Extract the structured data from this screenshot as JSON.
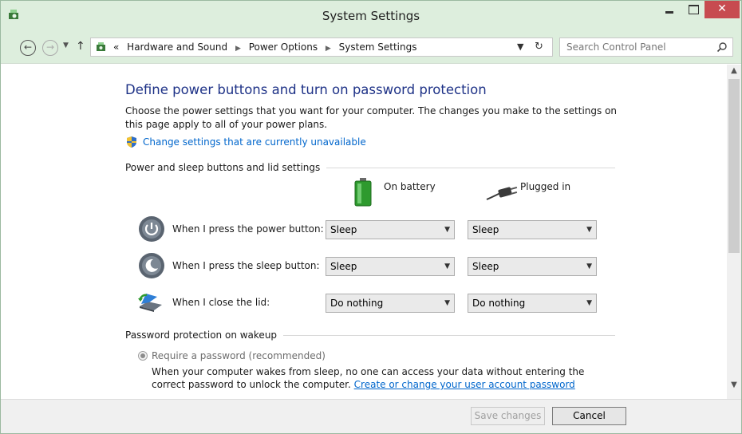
{
  "window": {
    "title": "System Settings"
  },
  "address_bar": {
    "prefix": "«",
    "crumbs": [
      "Hardware and Sound",
      "Power Options",
      "System Settings"
    ],
    "search_placeholder": "Search Control Panel"
  },
  "page": {
    "heading": "Define power buttons and turn on password protection",
    "description": "Choose the power settings that you want for your computer. The changes you make to the settings on this page apply to all of your power plans.",
    "change_link": "Change settings that are currently unavailable"
  },
  "buttons_section": {
    "label": "Power and sleep buttons and lid settings",
    "col_battery": "On battery",
    "col_plugged": "Plugged in",
    "rows": [
      {
        "label": "When I press the power button:",
        "battery": "Sleep",
        "plugged": "Sleep"
      },
      {
        "label": "When I press the sleep button:",
        "battery": "Sleep",
        "plugged": "Sleep"
      },
      {
        "label": "When I close the lid:",
        "battery": "Do nothing",
        "plugged": "Do nothing"
      }
    ]
  },
  "password_section": {
    "label": "Password protection on wakeup",
    "radio_label": "Require a password (recommended)",
    "radio_desc": "When your computer wakes from sleep, no one can access your data without entering the correct password to unlock the computer.",
    "radio_link": "Create or change your user account password"
  },
  "footer": {
    "save": "Save changes",
    "cancel": "Cancel"
  },
  "colors": {
    "titlebar": "#ddeedd",
    "heading": "#1e3287",
    "link": "#0066cc",
    "close": "#c74b50"
  }
}
